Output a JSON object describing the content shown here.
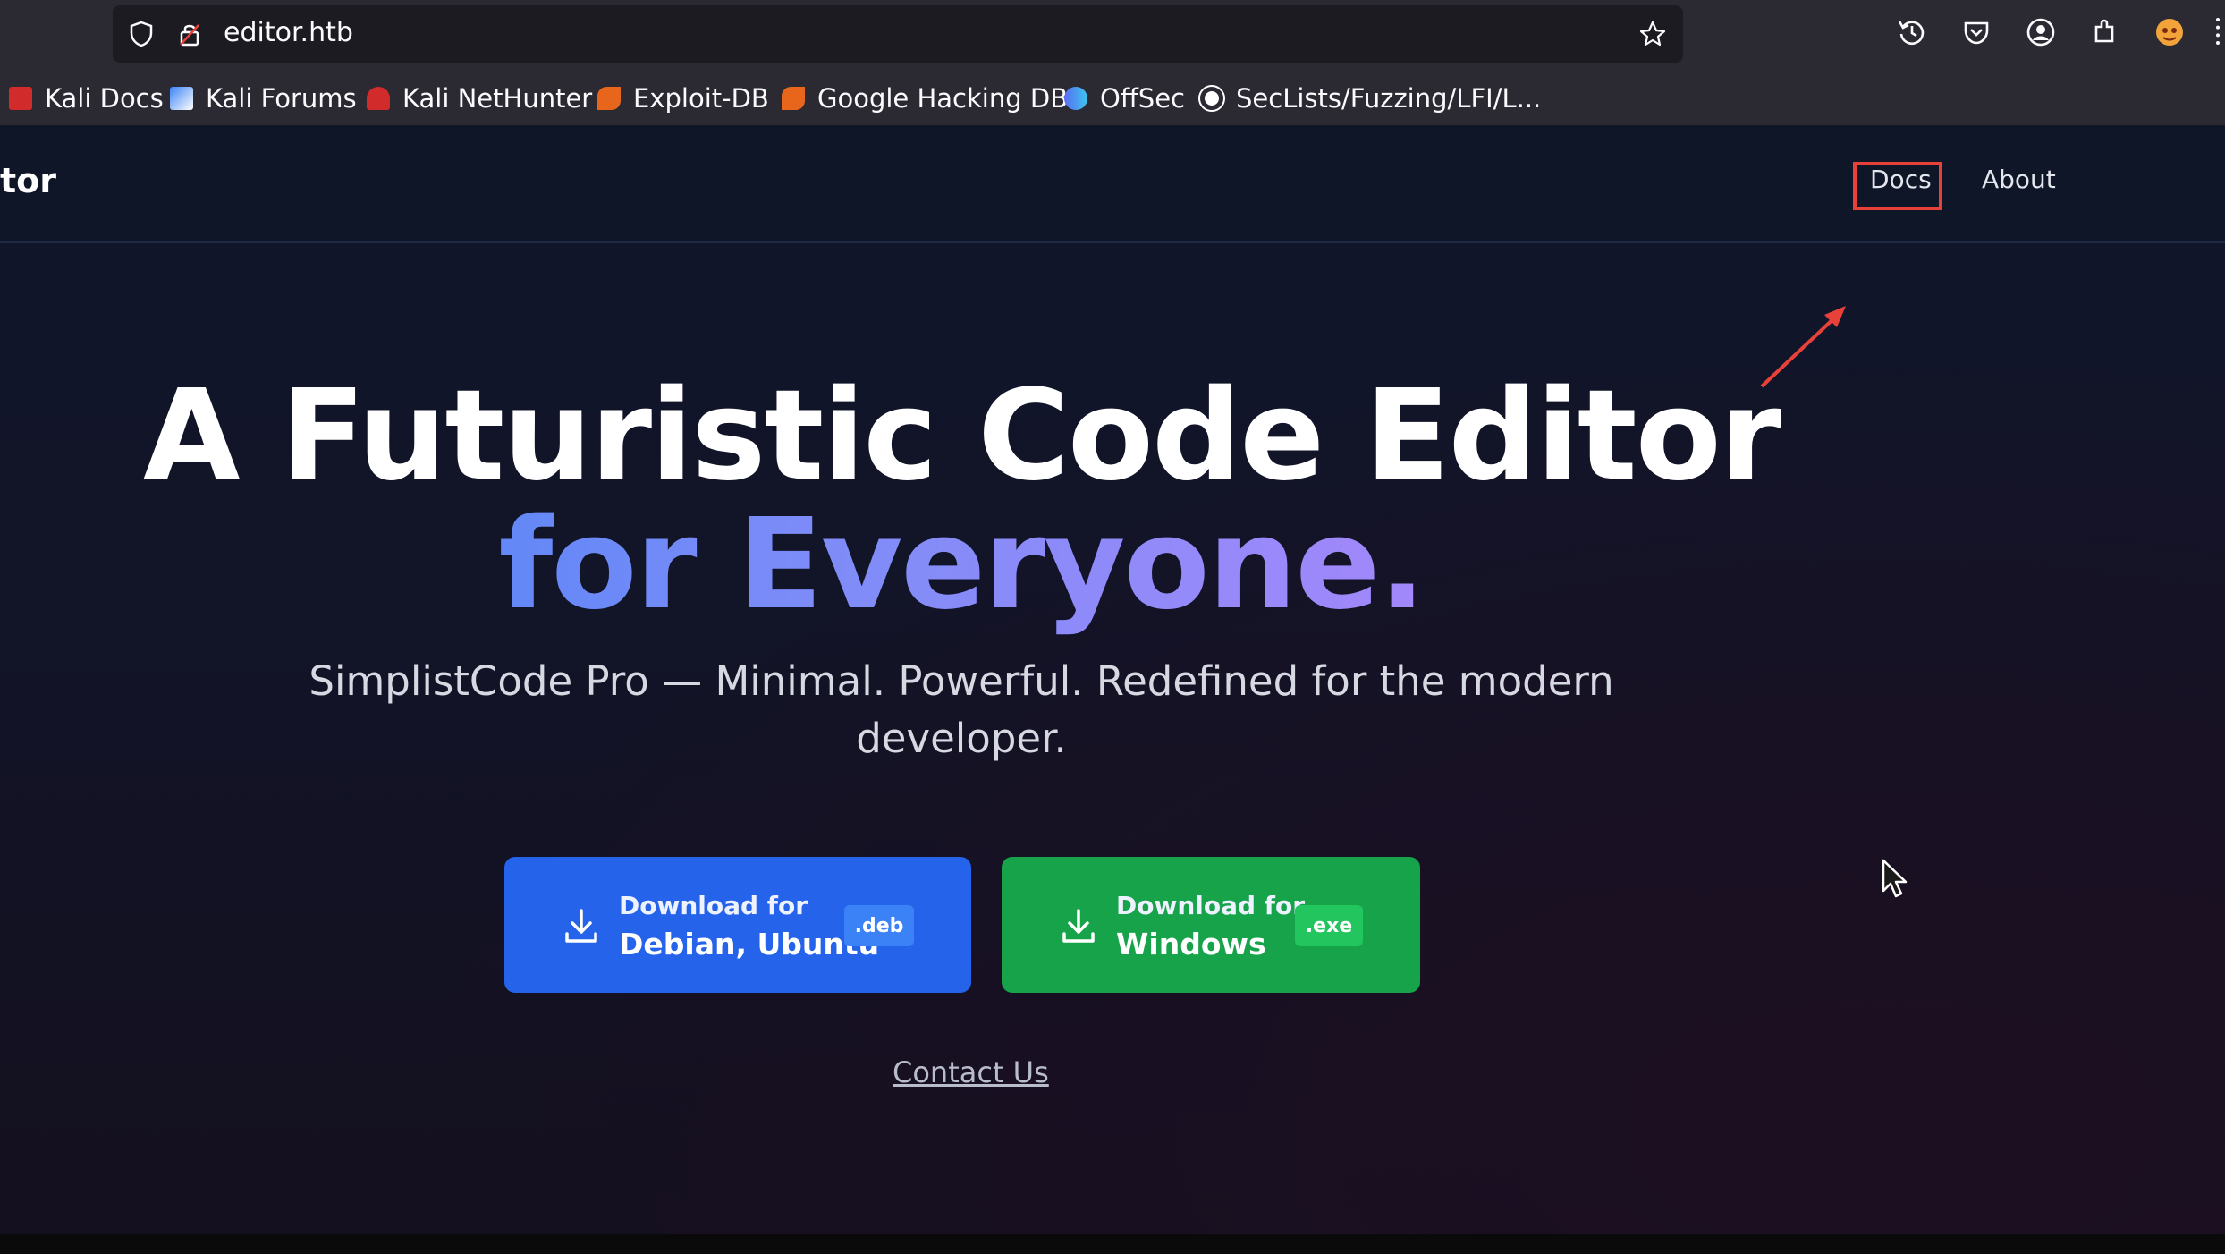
{
  "browser": {
    "url": "editor.htb",
    "bookmarks": [
      {
        "label": "Kali Docs",
        "icon": "kali-docs-icon",
        "color": "#d22b2b"
      },
      {
        "label": "Kali Forums",
        "icon": "kali-forums-icon",
        "color": "#3b82f6"
      },
      {
        "label": "Kali NetHunter",
        "icon": "kali-nethunter-icon",
        "color": "#d22b2b"
      },
      {
        "label": "Exploit-DB",
        "icon": "exploit-db-icon",
        "color": "#e8661c"
      },
      {
        "label": "Google Hacking DB",
        "icon": "ghdb-icon",
        "color": "#e8661c"
      },
      {
        "label": "OffSec",
        "icon": "offsec-icon",
        "color": "#5b6cf0"
      },
      {
        "label": "SecLists/Fuzzing/LFI/L...",
        "icon": "github-icon",
        "color": "#ffffff"
      }
    ]
  },
  "site": {
    "brand": "tor",
    "nav": {
      "docs": "Docs",
      "about": "About"
    },
    "hero": {
      "line1": "A Futuristic Code Editor",
      "line2": "for Everyone.",
      "subtitle": "SimplistCode Pro — Minimal. Powerful. Redefined for the modern developer."
    },
    "downloads": [
      {
        "top": "Download for",
        "bottom": "Debian, Ubuntu",
        "ext": ".deb",
        "color": "#2563eb"
      },
      {
        "top": "Download for",
        "bottom": "Windows",
        "ext": ".exe",
        "color": "#16a34a"
      }
    ],
    "contact": "Contact Us"
  },
  "annotation": {
    "highlight_color": "#e8413a"
  }
}
